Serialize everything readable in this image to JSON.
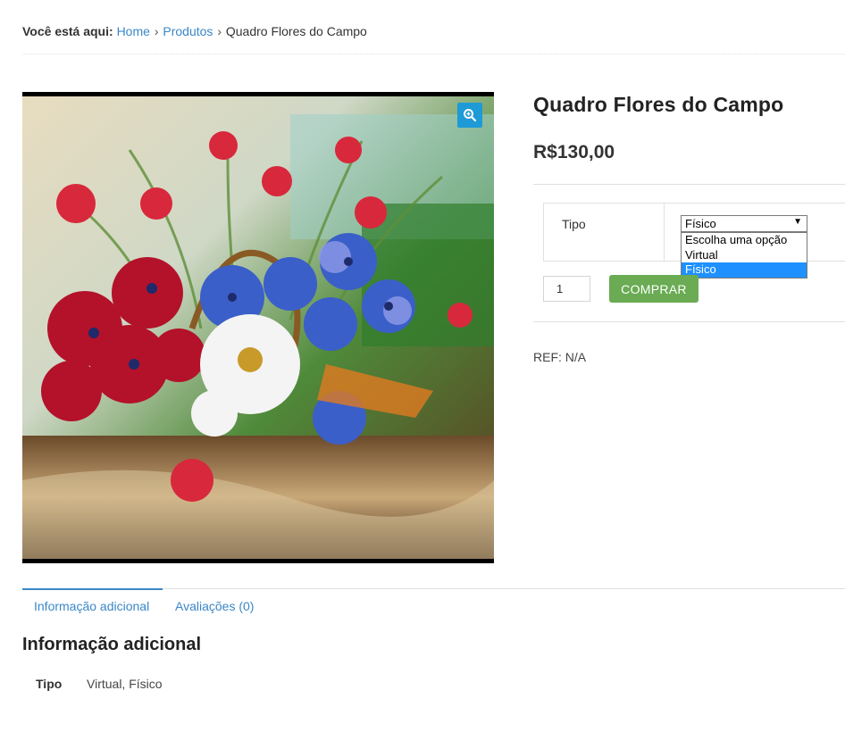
{
  "breadcrumb": {
    "label": "Você está aqui:",
    "items": [
      "Home",
      "Produtos",
      "Quadro Flores do Campo"
    ],
    "separator": "›"
  },
  "product": {
    "title": "Quadro Flores do Campo",
    "price": "R$130,00",
    "image_icon": "zoom-icon",
    "ref": "REF: N/A"
  },
  "variations": {
    "label": "Tipo",
    "selected": "Físico",
    "options": [
      "Escolha uma opção",
      "Virtual",
      "Físico"
    ]
  },
  "cart": {
    "quantity": "1",
    "buy_label": "COMPRAR",
    "buy_color": "#6aab53"
  },
  "tabs": [
    {
      "label": "Informação adicional",
      "active": true
    },
    {
      "label": "Avaliações (0)",
      "active": false
    }
  ],
  "additional_info": {
    "heading": "Informação adicional",
    "attributes": [
      {
        "label": "Tipo",
        "value": "Virtual, Físico"
      }
    ]
  },
  "colors": {
    "link": "#3a87c8",
    "zoom_button": "#1e9ad6",
    "dropdown_highlight": "#1e90ff"
  }
}
